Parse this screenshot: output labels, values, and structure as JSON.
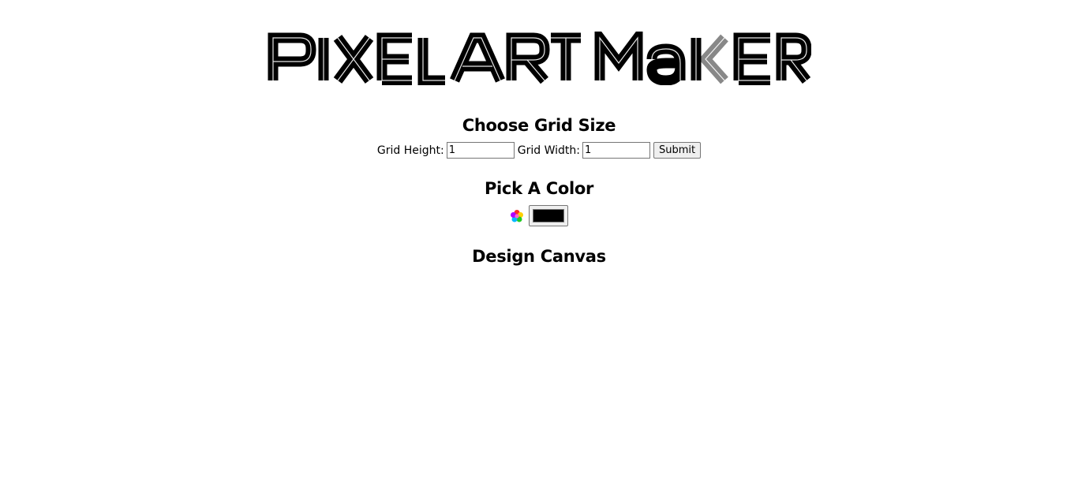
{
  "header": {
    "logo_text": "Pixel Art Maker"
  },
  "grid_section": {
    "title": "Choose Grid Size",
    "height_label": "Grid Height:",
    "height_value": "1",
    "width_label": "Grid Width:",
    "width_value": "1",
    "submit_label": "Submit"
  },
  "color_section": {
    "title": "Pick A Color",
    "picker_icon": "color-wheel-icon",
    "selected_color": "#000000"
  },
  "canvas_section": {
    "title": "Design Canvas"
  }
}
